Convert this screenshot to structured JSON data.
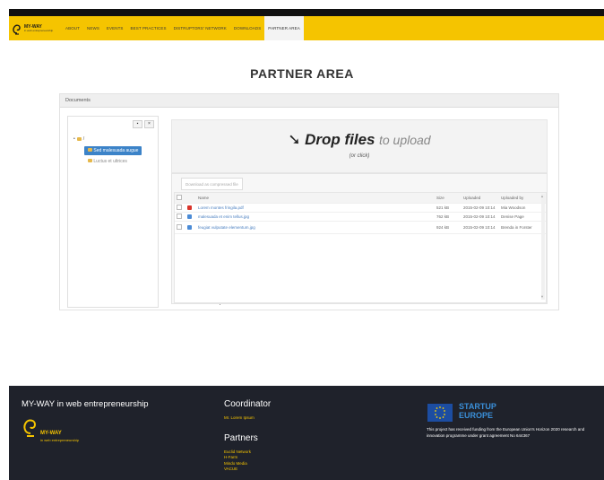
{
  "brand": {
    "name": "MY-WAY",
    "tagline": "in web entrepreneurship"
  },
  "nav": {
    "items": [
      "ABOUT",
      "NEWS",
      "EVENTS",
      "BEST PRACTICES",
      "DISTRUPTORS' NETWORK",
      "DOWNLOADS",
      "PARTNER AREA"
    ],
    "active": "PARTNER AREA"
  },
  "page": {
    "title": "PARTNER AREA"
  },
  "documents": {
    "header": "Documents",
    "tree": {
      "root": "/",
      "selected": "Sed malesuada augue",
      "child": "Luctus et ultrices"
    },
    "upload": {
      "main": "Drop files",
      "sub": "to upload",
      "hint": "(or click)"
    },
    "download_button": "Download as compressed file",
    "columns": {
      "name": "Name",
      "size": "Size",
      "uploaded": "Uploaded",
      "uploaded_by": "Uploaded by"
    },
    "files": [
      {
        "type": "pdf",
        "name": "Lorem montes fringila.pdf",
        "size": "521 kB",
        "uploaded": "2015-02-09 10:14",
        "by": "Mia Woodson"
      },
      {
        "type": "jpg",
        "name": "malesuada et enim tellus.jpg",
        "size": "762 kB",
        "uploaded": "2015-02-09 10:14",
        "by": "Denise Page"
      },
      {
        "type": "jpg",
        "name": "feugiat vulputate elementum.jpg",
        "size": "924 kB",
        "uploaded": "2015-02-09 10:14",
        "by": "Brenda in Forster"
      }
    ]
  },
  "footer": {
    "title": "MY-WAY in web entrepreneurship",
    "logo_name": "MY-WAY",
    "logo_tagline": "in web entrepreneurship",
    "coordinator_heading": "Coordinator",
    "coordinator": "Mr. Lorem Ipsum",
    "partners_heading": "Partners",
    "partners": [
      "Euclid Network",
      "H-Farm",
      "Mindo Media",
      "VACUE"
    ],
    "startup_logo": {
      "line1": "STARTUP",
      "line2": "EUROPE"
    },
    "funding_text": "This project has received funding from the European Union's Horizon 2020 research and innovation programme under grant agreement No 644367"
  },
  "colors": {
    "brand_yellow": "#f5c400",
    "footer_bg": "#1f222b",
    "selected_blue": "#3c83c8",
    "link_blue": "#4a7fc0"
  }
}
